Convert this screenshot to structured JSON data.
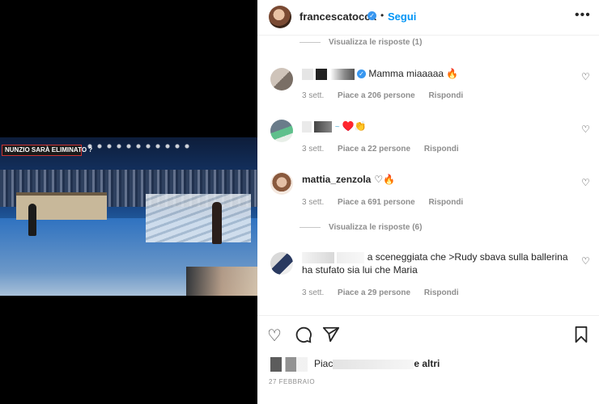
{
  "post": {
    "username": "francescatocca",
    "follow_label": "Segui",
    "more_label": "•••",
    "overlay_banner": "NUNZIO SARÀ ELIMINATO ?"
  },
  "comments": [
    {
      "view_replies": "Visualizza le risposte (1)"
    },
    {
      "user": "",
      "text": "Mamma miaaaaa 🔥",
      "time": "3 sett.",
      "likes": "Piace a 206 persone",
      "reply": "Rispondi"
    },
    {
      "user": "",
      "text": "♥️👏",
      "time": "3 sett.",
      "likes": "Piace a 22 persone",
      "reply": "Rispondi"
    },
    {
      "user": "mattia_zenzola",
      "text": "♡🔥",
      "time": "3 sett.",
      "likes": "Piace a 691 persone",
      "reply": "Rispondi",
      "view_replies": "Visualizza le risposte (6)"
    },
    {
      "user": "",
      "text": "a sceneggiata che >Rudy sbava sulla ballerina ha stufato sia lui che Maria",
      "time": "3 sett.",
      "likes": "Piace a 29 persone",
      "reply": "Rispondi"
    }
  ],
  "footer": {
    "likes_prefix": "Piac",
    "likes_suffix": "e altri",
    "date": "27 FEBBRAIO"
  },
  "icons": [
    "heart-icon",
    "comment-icon",
    "share-icon",
    "bookmark-icon",
    "more-icon",
    "verified-icon"
  ],
  "colors": {
    "link": "#0095f6",
    "verified": "#3897f0",
    "muted": "#8e8e8e",
    "text": "#262626"
  }
}
